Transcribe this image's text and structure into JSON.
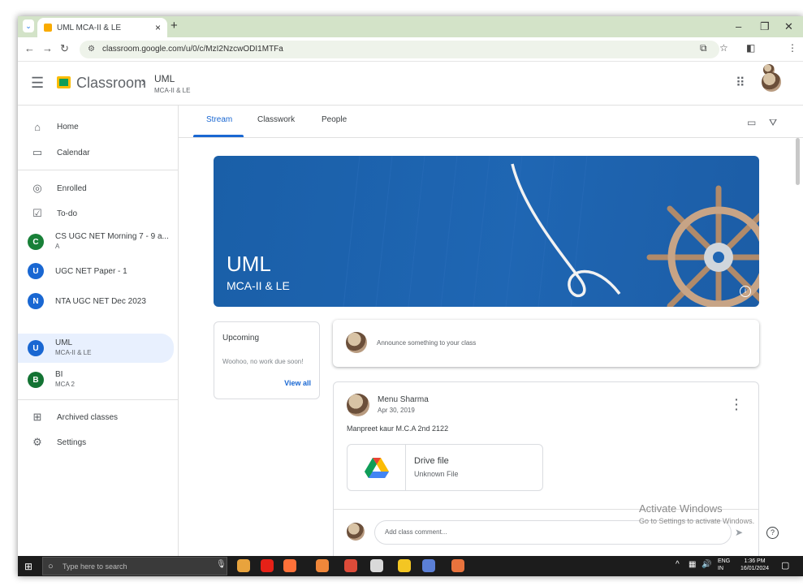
{
  "browser": {
    "tab_title": "UML MCA-II & LE",
    "new_tab": "+",
    "url": "classroom.google.com/u/0/c/MzI2NzcwODI1MTFa",
    "controls": {
      "minimize": "–",
      "maximize": "❐",
      "close": "✕"
    }
  },
  "header": {
    "brand": "Classroom",
    "crumb_title": "UML",
    "crumb_subtitle": "MCA-II & LE"
  },
  "sidebar": {
    "items": [
      {
        "label": "Home",
        "icon": "home-icon"
      },
      {
        "label": "Calendar",
        "icon": "calendar-icon"
      },
      {
        "label": "Enrolled",
        "icon": "enrolled-icon"
      },
      {
        "label": "To-do",
        "icon": "todo-icon"
      }
    ],
    "classes": [
      {
        "letter": "C",
        "name": "CS UGC NET Morning 7 - 9 a...",
        "sub": "A",
        "color": "#188038"
      },
      {
        "letter": "U",
        "name": "UGC NET Paper - 1",
        "sub": "",
        "color": "#1967d2"
      },
      {
        "letter": "N",
        "name": "NTA UGC NET Dec 2023",
        "sub": "",
        "color": "#1967d2"
      },
      {
        "letter": "U",
        "name": "UML",
        "sub": "MCA-II & LE",
        "color": "#1967d2"
      },
      {
        "letter": "B",
        "name": "BI",
        "sub": "MCA 2",
        "color": "#137333"
      }
    ],
    "bottom": [
      {
        "label": "Archived classes",
        "icon": "archive-icon"
      },
      {
        "label": "Settings",
        "icon": "settings-icon"
      }
    ]
  },
  "tabs": {
    "stream": "Stream",
    "classwork": "Classwork",
    "people": "People"
  },
  "banner": {
    "title": "UML",
    "subtitle": "MCA-II & LE"
  },
  "upcoming": {
    "title": "Upcoming",
    "text": "Woohoo, no work due soon!",
    "link": "View all"
  },
  "announce": {
    "placeholder": "Announce something to your class"
  },
  "post": {
    "author": "Menu Sharma",
    "date": "Apr 30, 2019",
    "body": "Manpreet kaur M.C.A 2nd 2122",
    "attachment_name": "Drive file",
    "attachment_type": "Unknown File",
    "comment_placeholder": "Add class comment..."
  },
  "watermark": {
    "line1": "Activate Windows",
    "line2": "Go to Settings to activate Windows."
  },
  "taskbar": {
    "search_placeholder": "Type here to search",
    "lang": "ENG",
    "region": "IN",
    "time": "1:36 PM",
    "date": "16/01/2024"
  },
  "colors": {
    "accent": "#1967d2",
    "banner": "#1a5fa8",
    "tabbar": "#d3e3c8"
  }
}
